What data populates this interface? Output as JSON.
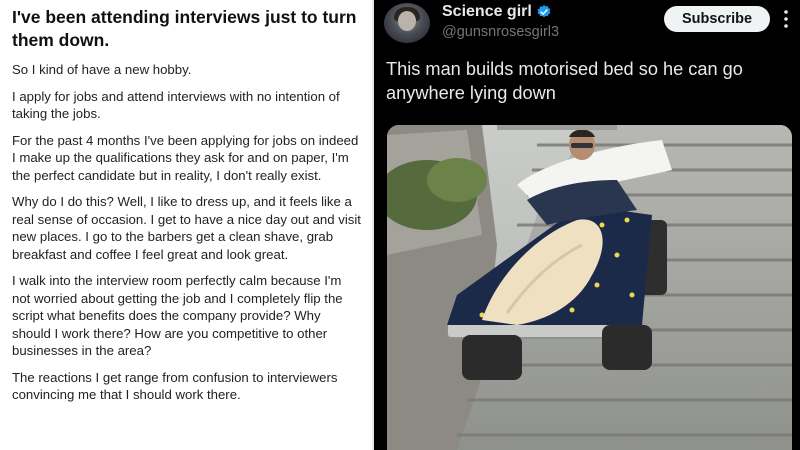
{
  "reddit_post": {
    "title": "I've been attending interviews just to turn them down.",
    "paragraphs": [
      "So I kind of have a new hobby.",
      "I apply for jobs and attend interviews with no intention of taking the jobs.",
      "For the past 4 months I've been applying for jobs on indeed I make up the qualifications they ask for and on paper, I'm the perfect candidate but in reality, I don't really exist.",
      "Why do I do this? Well, I like to dress up, and it feels like a real sense of occasion. I get to have a nice day out and visit new places. I go to the barbers get a clean shave, grab breakfast and coffee I feel great and look great.",
      "I walk into the interview room perfectly calm because I'm not worried about getting the job and I completely flip the script what benefits does the company provide? Why should I work there? How are you competitive to other businesses in the area?",
      "The reactions I get range from confusion to interviewers convincing me that I should work there."
    ]
  },
  "tweet": {
    "display_name": "Science girl",
    "handle": "@gunsnrosesgirl3",
    "subscribe_label": "Subscribe",
    "text": "This man builds motorised bed so he can go anywhere lying down",
    "verified_icon": "verified-badge-icon",
    "more_icon": "more-options-icon",
    "accent_color": "#1d9bf0"
  },
  "colors": {
    "left_bg": "#ffffff",
    "right_bg": "#000000",
    "tweet_text": "#e7e9ea",
    "handle_text": "#71767b",
    "subscribe_bg": "#eff3f4"
  }
}
